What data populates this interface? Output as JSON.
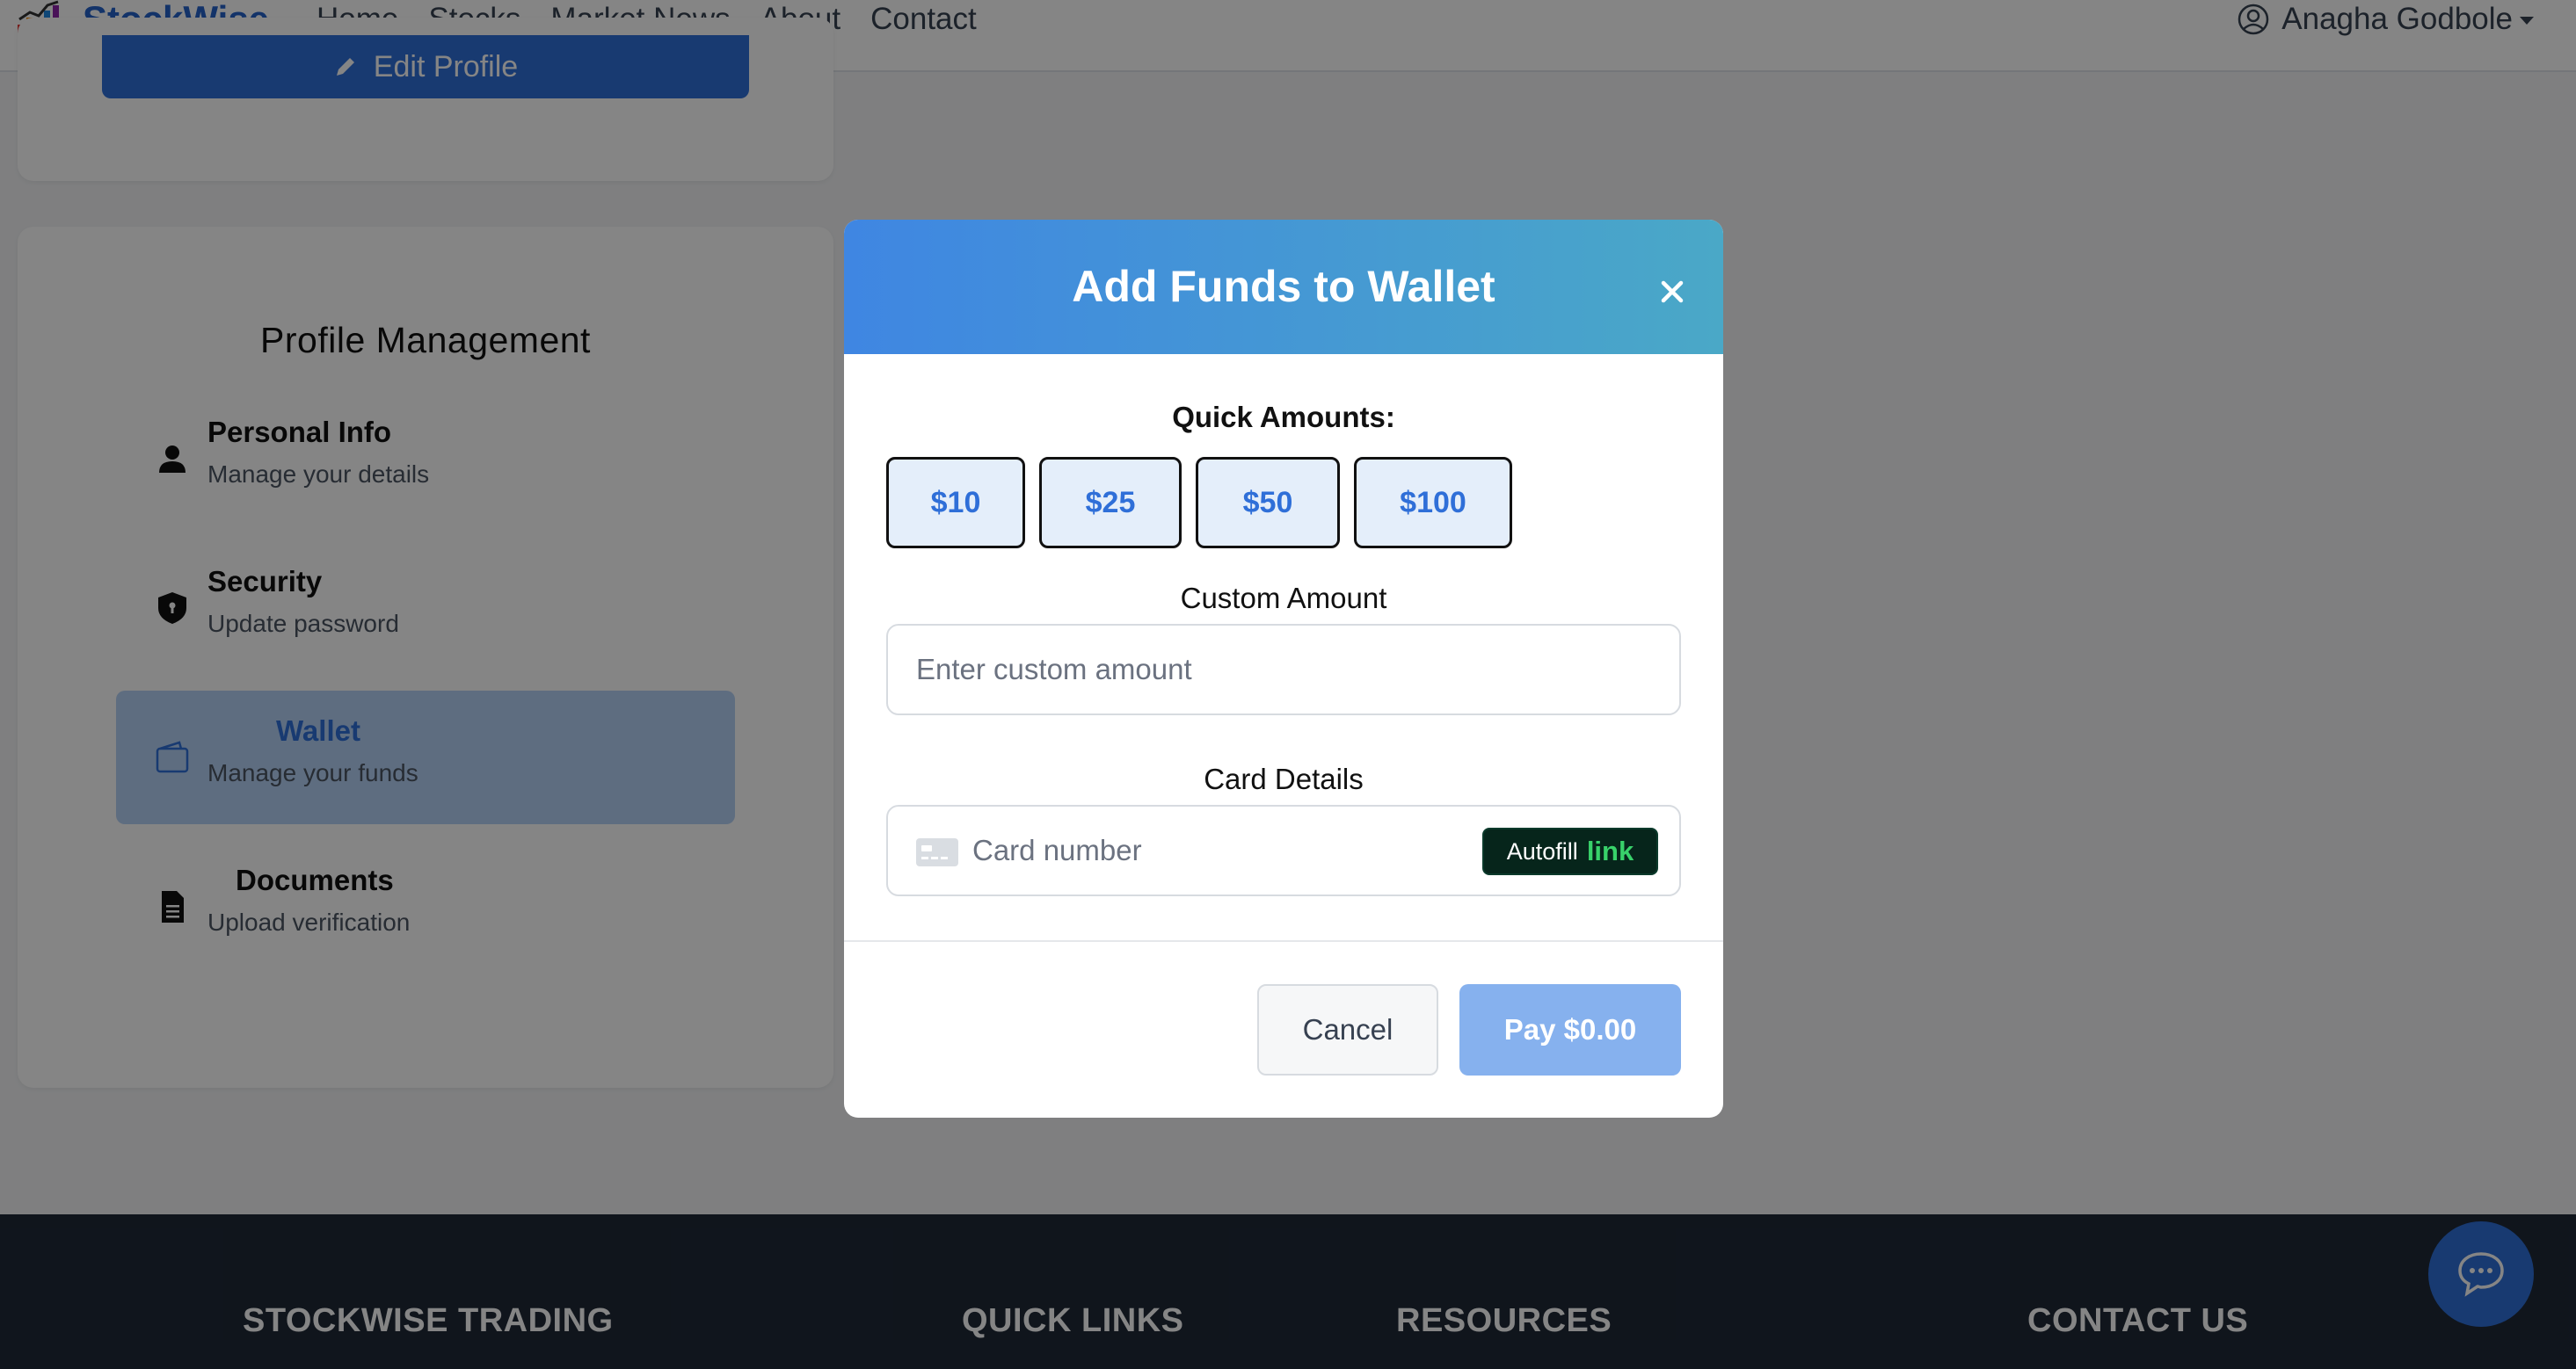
{
  "nav": {
    "brand": "StockWise",
    "links": [
      "Home",
      "Stocks",
      "Market News",
      "About",
      "Contact"
    ],
    "user_name": "Anagha Godbole"
  },
  "profile_card": {
    "edit_label": "Edit Profile"
  },
  "profile_management": {
    "title": "Profile Management",
    "items": [
      {
        "label": "Personal Info",
        "sub": "Manage your details",
        "icon": "person-icon"
      },
      {
        "label": "Security",
        "sub": "Update password",
        "icon": "shield-icon"
      },
      {
        "label": "Wallet",
        "sub": "Manage your funds",
        "icon": "wallet-icon",
        "active": true
      },
      {
        "label": "Documents",
        "sub": "Upload verification",
        "icon": "document-icon"
      }
    ]
  },
  "modal": {
    "title": "Add Funds to Wallet",
    "quick_label": "Quick Amounts:",
    "quick_amounts": [
      "$10",
      "$25",
      "$50",
      "$100"
    ],
    "custom_label": "Custom Amount",
    "custom_placeholder": "Enter custom amount",
    "card_label": "Card Details",
    "card_placeholder": "Card number",
    "autofill_text": "Autofill",
    "autofill_link": "link",
    "cancel_label": "Cancel",
    "pay_label": "Pay $0.00"
  },
  "footer": {
    "headings": [
      "STOCKWISE TRADING",
      "QUICK LINKS",
      "RESOURCES",
      "CONTACT US"
    ]
  },
  "colors": {
    "brand_blue": "#2f6fd8",
    "header_gradient_start": "#3f86e2",
    "header_gradient_end": "#4aa8c7",
    "link_green": "#38d16a",
    "footer_bg": "#1f2937"
  }
}
